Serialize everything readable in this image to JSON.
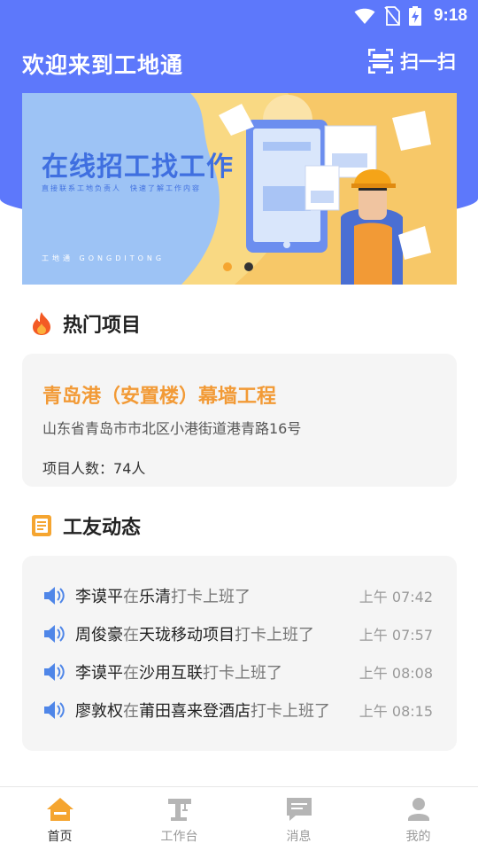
{
  "status_bar": {
    "time": "9:18"
  },
  "header": {
    "title": "欢迎来到工地通",
    "scan_label": "扫一扫"
  },
  "banner": {
    "headline": "在线招工找工作",
    "subline": "直接联系工地负责人　快速了解工作内容",
    "brand": "工地通 GONGDITONG",
    "active_slide_index": 0,
    "slide_count": 2,
    "dot_colors": [
      "#f5a530",
      "#333333"
    ]
  },
  "hot_section": {
    "title": "热门项目",
    "icon": "fire-icon"
  },
  "project": {
    "name": "青岛港（安置楼）幕墙工程",
    "address": "山东省青岛市市北区小港街道港青路16号",
    "count_label": "项目人数：",
    "count_value": "74人"
  },
  "feed_section": {
    "title": "工友动态",
    "icon": "notepad-icon"
  },
  "feed": [
    {
      "name": "李谟平",
      "conn": "在",
      "place": "乐清",
      "action": "打卡上班了",
      "time": "上午 07:42"
    },
    {
      "name": "周俊豪",
      "conn": "在",
      "place": "天珑移动项目",
      "action": "打卡上班了",
      "time": "上午 07:57"
    },
    {
      "name": "李谟平",
      "conn": "在",
      "place": "沙用互联",
      "action": "打卡上班了",
      "time": "上午 08:08"
    },
    {
      "name": "廖敦权",
      "conn": "在",
      "place": "莆田喜来登酒店",
      "action": "打卡上班了",
      "time": "上午 08:15"
    }
  ],
  "tabs": [
    {
      "label": "首页",
      "icon": "home-icon",
      "active": true
    },
    {
      "label": "工作台",
      "icon": "workbench-icon",
      "active": false
    },
    {
      "label": "消息",
      "icon": "message-icon",
      "active": false
    },
    {
      "label": "我的",
      "icon": "user-icon",
      "active": false
    }
  ],
  "colors": {
    "primary": "#5d78fb",
    "accent": "#f29a36",
    "card_bg": "#f5f5f5",
    "tab_active": "#f5a530",
    "tab_inactive": "#b5b5b5"
  }
}
